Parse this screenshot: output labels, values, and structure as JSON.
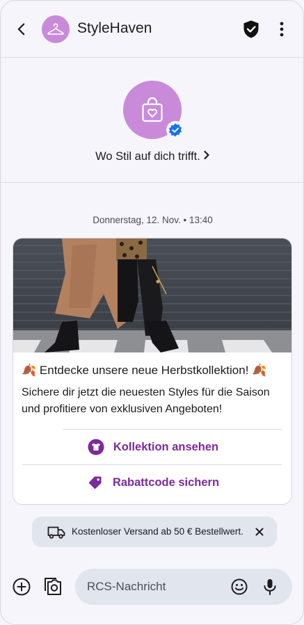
{
  "header": {
    "title": "StyleHaven",
    "icons": {
      "back": "arrow-back-icon",
      "avatar": "hanger-icon",
      "verified": "verified-shield-icon",
      "more": "more-vert-icon"
    }
  },
  "profile": {
    "tagline": "Wo Stil auf dich trifft.",
    "tagline_chevron": "›",
    "icons": {
      "avatar": "shopping-bag-heart-icon",
      "badge": "verified-badge-icon"
    }
  },
  "conversation": {
    "timestamp": "Donnerstag, 12. Nov. • 13:40"
  },
  "card": {
    "title_prefix_emoji": "🍂",
    "title": "Entdecke unsere neue Herbstkollektion!",
    "title_suffix_emoji": "🍂",
    "body": "Sichere dir jetzt die neuesten Styles für die Saison und profitiere von exklusiven Angeboten!",
    "image_icon": "fashion-photo-coat-boots",
    "actions": [
      {
        "label": "Kollektion ansehen",
        "icon": "shirt-icon"
      },
      {
        "label": "Rabattcode sichern",
        "icon": "tag-icon"
      }
    ]
  },
  "banner": {
    "text": "Kostenloser Versand ab 50 € Bestellwert.",
    "icon": "truck-icon",
    "close_icon": "close-icon"
  },
  "composer": {
    "placeholder": "RCS-Nachricht",
    "icons": {
      "add": "add-circle-icon",
      "gallery": "gallery-camera-icon",
      "emoji": "emoji-icon",
      "mic": "mic-icon"
    }
  },
  "colors": {
    "accent": "#7c2a9c",
    "avatar_bg": "#c98bd9",
    "verified_blue": "#1a73e8",
    "surface": "#f6f5fb",
    "chip": "#e1e5ee"
  }
}
